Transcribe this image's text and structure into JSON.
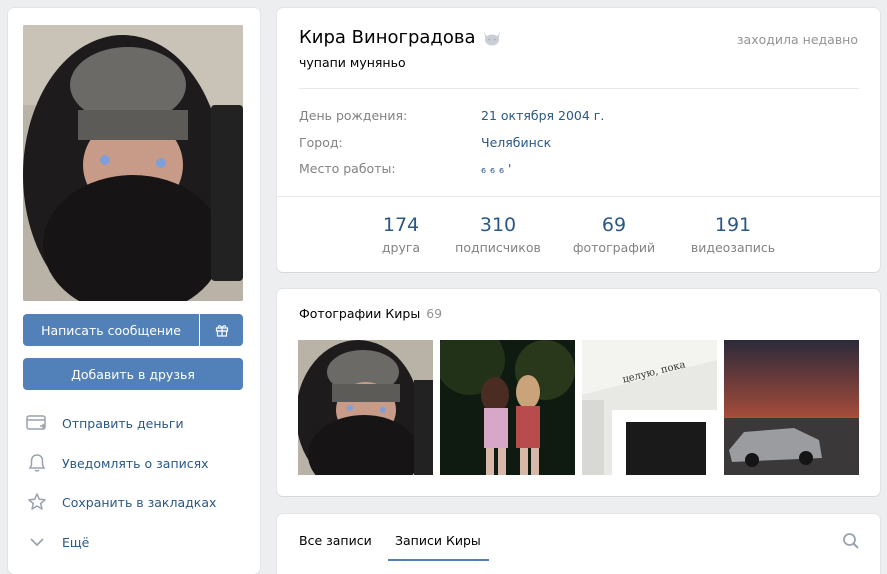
{
  "profile": {
    "name": "Кира Виноградова",
    "status": "чупапи муняньо",
    "online": "заходила недавно",
    "info": [
      {
        "key": "День рождения:",
        "value": "21 октября 2004 г."
      },
      {
        "key": "Город:",
        "value": "Челябинск"
      },
      {
        "key": "Место работы:",
        "value": "₆ ₆ ₆ '"
      }
    ],
    "counters": [
      {
        "num": "174",
        "cap": "друга"
      },
      {
        "num": "310",
        "cap": "подписчиков"
      },
      {
        "num": "69",
        "cap": "фотографий"
      },
      {
        "num": "191",
        "cap": "видеозапись"
      }
    ]
  },
  "left": {
    "write_label": "Написать сообщение",
    "add_label": "Добавить в друзья",
    "actions": [
      {
        "label": "Отправить деньги",
        "icon": "money-icon"
      },
      {
        "label": "Уведомлять о записях",
        "icon": "bell-icon"
      },
      {
        "label": "Сохранить в закладках",
        "icon": "star-icon"
      },
      {
        "label": "Ещё",
        "icon": "chevron-down-icon"
      }
    ]
  },
  "photos": {
    "title": "Фотографии Киры",
    "count": "69"
  },
  "wall": {
    "tab_all": "Все записи",
    "tab_kira": "Записи Киры"
  },
  "colors": {
    "accent": "#5181b8",
    "link": "#2a5885",
    "muted": "#828282",
    "background": "#edeef0"
  }
}
